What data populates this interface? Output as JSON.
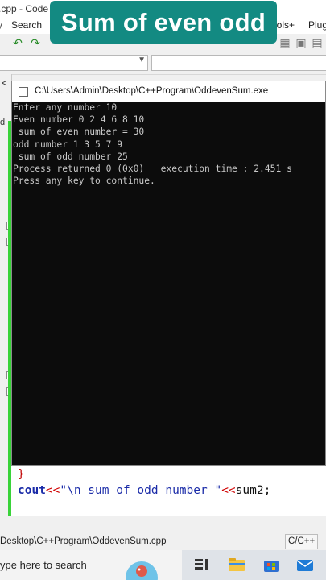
{
  "banner": {
    "text": "Sum of even odd"
  },
  "ide": {
    "title_fragment": ".cpp - Code",
    "menu": {
      "search": "Search",
      "tools": "ools+",
      "plugins": "Plug"
    }
  },
  "console": {
    "title": "C:\\Users\\Admin\\Desktop\\C++Program\\OddevenSum.exe",
    "lines": [
      "Enter any number 10",
      "Even number 0 2 4 6 8 10",
      " sum of even number = 30",
      "odd number 1 3 5 7 9",
      " sum of odd number 25",
      "Process returned 0 (0x0)   execution time : 2.451 s",
      "Press any key to continue."
    ]
  },
  "editor": {
    "brace": "}",
    "code": {
      "kw": "cout",
      "op1": "<<",
      "str": "\"\\n sum of odd number \"",
      "op2": "<<",
      "id": "sum2;"
    }
  },
  "statusbar": {
    "path": "Desktop\\C++Program\\OddevenSum.cpp",
    "language": "C/C++"
  },
  "taskbar": {
    "search_placeholder": "ype here to search"
  },
  "colors": {
    "banner": "#138a82",
    "console_bg": "#0c0c0c",
    "console_text": "#c8c8c8",
    "change_bar": "#39d339"
  },
  "icons": [
    "folder-icon",
    "store-icon",
    "mail-icon",
    "task-view-icon",
    "chevron-down-icon"
  ]
}
